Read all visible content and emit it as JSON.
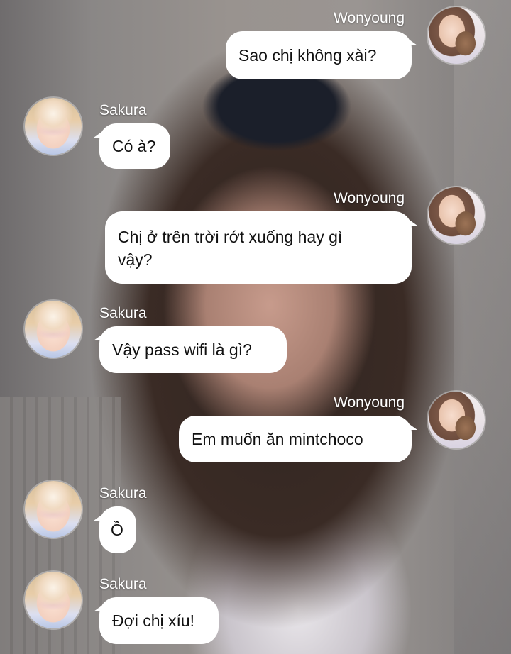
{
  "app": {
    "accent_bubble": "#ffffff",
    "background_style": "photo"
  },
  "names": {
    "wonyoung": "Wonyoung",
    "sakura": "Sakura"
  },
  "messages": [
    {
      "sender": "Wonyoung",
      "side": "right",
      "lines": [
        "Sao chị không xài?"
      ]
    },
    {
      "sender": "Sakura",
      "side": "left",
      "lines": [
        "Có à?"
      ]
    },
    {
      "sender": "Wonyoung",
      "side": "right",
      "lines": [
        "Chị ở trên trời rớt xuống hay gì",
        "vậy?"
      ]
    },
    {
      "sender": "Sakura",
      "side": "left",
      "lines": [
        "Vậy pass wifi là gì?"
      ]
    },
    {
      "sender": "Wonyoung",
      "side": "right",
      "lines": [
        "Em muốn ăn mintchoco"
      ]
    },
    {
      "sender": "Sakura",
      "side": "left",
      "lines": [
        "Ồ"
      ]
    },
    {
      "sender": "Sakura",
      "side": "left",
      "lines": [
        "Đợi chị xíu!"
      ]
    }
  ]
}
